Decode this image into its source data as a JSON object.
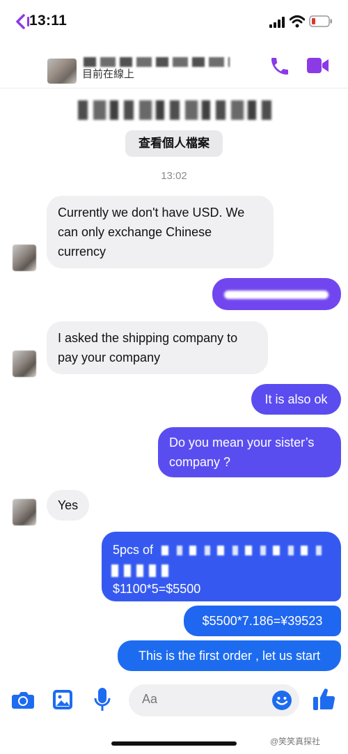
{
  "status_bar": {
    "time": "13:11"
  },
  "header": {
    "subtitle": "目前在線上"
  },
  "profile": {
    "view_profile": "查看個人檔案"
  },
  "conversation": {
    "timestamp": "13:02",
    "messages": [
      {
        "dir": "in",
        "text": "Currently we don't have USD. We can only exchange Chinese currency"
      },
      {
        "dir": "out",
        "text": ""
      },
      {
        "dir": "in",
        "text": "I asked the shipping company to pay your company"
      },
      {
        "dir": "out",
        "text": "It is also ok"
      },
      {
        "dir": "out",
        "text": "Do you mean your sister’s company ?"
      },
      {
        "dir": "in",
        "text": "Yes"
      },
      {
        "dir": "out",
        "text_line1": "5pcs of",
        "text_line3": "$1100*5=$5500"
      },
      {
        "dir": "out",
        "text": "$5500*7.186=¥39523"
      },
      {
        "dir": "out",
        "text": "This is the first order , let us start"
      }
    ]
  },
  "composer": {
    "placeholder": "Aa"
  },
  "watermark": "@笑笑真探社",
  "colors": {
    "accent": "#7b3cf0",
    "bubble_purple": "#6a4cf0",
    "bubble_blue": "#1d5cf0",
    "incoming": "#f0f0f2"
  },
  "icons": [
    "back-icon",
    "phone-icon",
    "video-icon",
    "camera-icon",
    "image-icon",
    "mic-icon",
    "emoji-icon",
    "thumbs-up-icon"
  ]
}
